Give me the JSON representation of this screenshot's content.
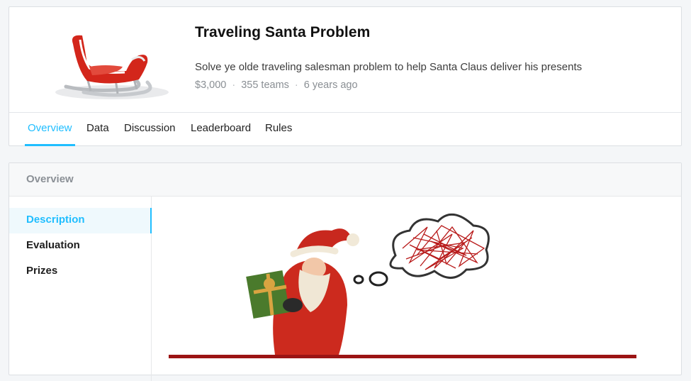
{
  "competition": {
    "title": "Traveling Santa Problem",
    "description": "Solve ye olde traveling salesman problem to help Santa Claus deliver his presents",
    "prize": "$3,000",
    "teams": "355 teams",
    "age": "6 years ago",
    "separator": "·"
  },
  "tabs": [
    {
      "label": "Overview",
      "active": true
    },
    {
      "label": "Data",
      "active": false
    },
    {
      "label": "Discussion",
      "active": false
    },
    {
      "label": "Leaderboard",
      "active": false
    },
    {
      "label": "Rules",
      "active": false
    }
  ],
  "overview": {
    "heading": "Overview",
    "sidebar": [
      {
        "label": "Description",
        "active": true
      },
      {
        "label": "Evaluation",
        "active": false
      },
      {
        "label": "Prizes",
        "active": false
      }
    ]
  },
  "colors": {
    "accent": "#20beff",
    "santa_red": "#c8281e",
    "ground_line": "#9b1414"
  },
  "icons": {
    "header_image": "sleigh-image",
    "content_image": "santa-thought-bubble-image"
  }
}
